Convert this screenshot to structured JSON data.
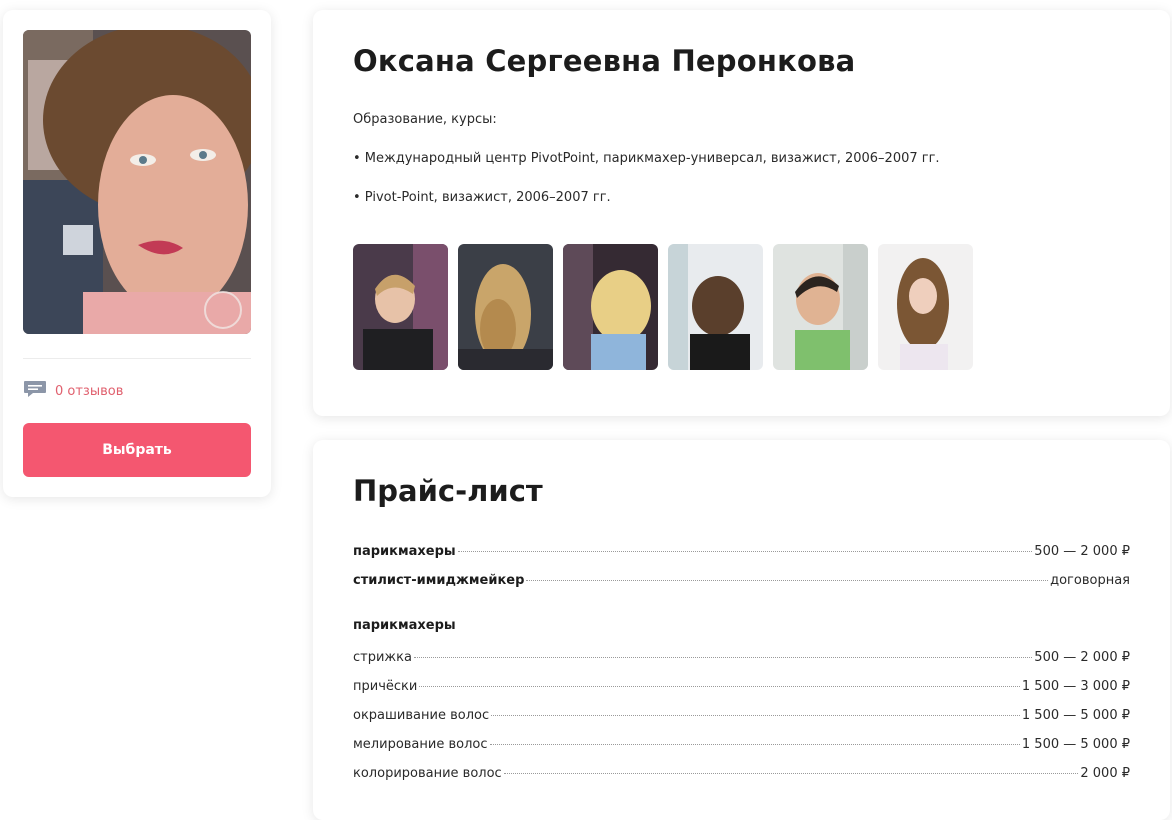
{
  "profile": {
    "reviews_text": "0 отзывов",
    "select_label": "Выбрать"
  },
  "master": {
    "name": "Оксана Сергеевна Перонкова",
    "education_heading": "Образование, курсы:",
    "education_items": [
      "• Международный центр PivotPoint, парикмахер-универсал, визажист, 2006–2007 гг.",
      "• Pivot-Point, визажист, 2006–2007 гг."
    ]
  },
  "price_list": {
    "title": "Прайс-лист",
    "summary": [
      {
        "label": "парикмахеры",
        "price": "500 — 2 000 ₽"
      },
      {
        "label": "стилист-имиджмейкер",
        "price": "договорная"
      }
    ],
    "section_title": "парикмахеры",
    "items": [
      {
        "label": "стрижка",
        "price": "500 — 2 000 ₽"
      },
      {
        "label": "причёски",
        "price": "1 500 — 3 000 ₽"
      },
      {
        "label": "окрашивание волос",
        "price": "1 500 — 5 000 ₽"
      },
      {
        "label": "мелирование волос",
        "price": "1 500 — 5 000 ₽"
      },
      {
        "label": "колорирование волос",
        "price": "2 000 ₽"
      }
    ]
  },
  "colors": {
    "accent": "#f45770",
    "reviews_text": "#e0606e",
    "icon": "#8c96a8"
  },
  "icons": {
    "reviews": "comment-icon"
  }
}
